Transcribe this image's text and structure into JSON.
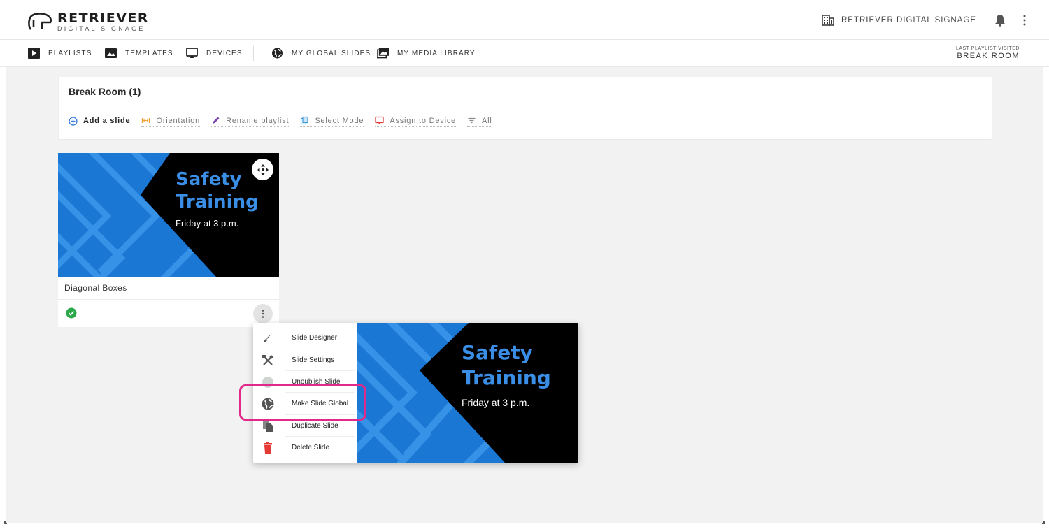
{
  "header": {
    "logo_title": "RETRIEVER",
    "logo_subtitle": "DIGITAL SIGNAGE",
    "org_name": "RETRIEVER DIGITAL SIGNAGE",
    "icons": [
      "building-icon",
      "bell-icon",
      "more-vert-icon"
    ]
  },
  "nav": {
    "items": [
      {
        "label": "PLAYLISTS",
        "icon": "playlist-icon"
      },
      {
        "label": "TEMPLATES",
        "icon": "image-icon"
      },
      {
        "label": "DEVICES",
        "icon": "cast-icon"
      },
      {
        "label": "MY GLOBAL SLIDES",
        "icon": "globe-icon"
      },
      {
        "label": "MY MEDIA LIBRARY",
        "icon": "media-library-icon"
      }
    ],
    "last_visited_label": "LAST PLAYLIST VISITED",
    "last_visited_value": "BREAK ROOM"
  },
  "playlist": {
    "title": "Break Room (1)",
    "toolbar": [
      {
        "label": "Add a slide",
        "icon": "add-circle-icon",
        "color": "#3b7ddd"
      },
      {
        "label": "Orientation",
        "icon": "orientation-icon",
        "color": "#f0a030"
      },
      {
        "label": "Rename playlist",
        "icon": "pencil-icon",
        "color": "#7b3fb0"
      },
      {
        "label": "Select Mode",
        "icon": "select-icon",
        "color": "#3b9ae0"
      },
      {
        "label": "Assign to Device",
        "icon": "cast-icon",
        "color": "#e03a3a"
      },
      {
        "label": "All",
        "icon": "filter-icon",
        "color": "#888888"
      }
    ]
  },
  "slide": {
    "name": "Diagonal Boxes",
    "heading_line1": "Safety",
    "heading_line2": "Training",
    "subtext": "Friday at 3 p.m.",
    "status": "published",
    "colors": {
      "blue": "#1a77d4",
      "stripe": "#3a95ea",
      "black": "#000000",
      "heading": "#3a8ee6",
      "status_green": "#2aa84a"
    }
  },
  "context_menu": {
    "items": [
      {
        "label": "Slide Designer",
        "icon": "brush-icon"
      },
      {
        "label": "Slide Settings",
        "icon": "tools-icon"
      },
      {
        "label": "Unpublish Slide",
        "icon": "unpublish-icon"
      },
      {
        "label": "Make Slide Global",
        "icon": "globe-icon"
      },
      {
        "label": "Duplicate Slide",
        "icon": "copy-icon"
      },
      {
        "label": "Delete Slide",
        "icon": "trash-icon"
      }
    ],
    "highlighted": "Make Slide Global",
    "highlight_color": "#e0298a"
  }
}
